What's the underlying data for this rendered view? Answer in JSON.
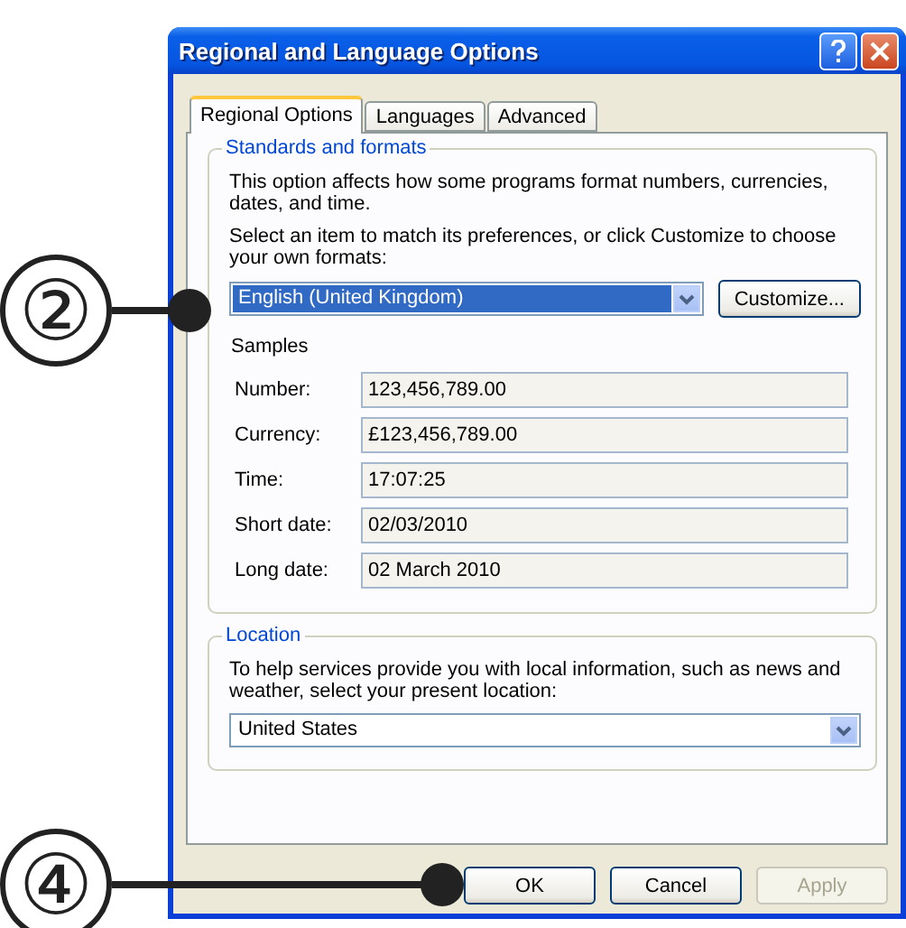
{
  "window": {
    "title": "Regional and Language Options"
  },
  "tabs": [
    {
      "label": "Regional Options",
      "selected": true
    },
    {
      "label": "Languages",
      "selected": false
    },
    {
      "label": "Advanced",
      "selected": false
    }
  ],
  "standards": {
    "legend": "Standards and formats",
    "description": "This option affects how some programs format numbers, currencies, dates, and time.",
    "instruction": "Select an item to match its preferences, or click Customize to choose your own formats:",
    "format": "English (United Kingdom)",
    "customize_button": "Customize...",
    "samples_label": "Samples",
    "samples": [
      {
        "label": "Number:",
        "value": "123,456,789.00"
      },
      {
        "label": "Currency:",
        "value": "£123,456,789.00"
      },
      {
        "label": "Time:",
        "value": "17:07:25"
      },
      {
        "label": "Short date:",
        "value": "02/03/2010"
      },
      {
        "label": "Long date:",
        "value": "02 March 2010"
      }
    ]
  },
  "location": {
    "legend": "Location",
    "description": "To help services provide you with local information, such as news and weather, select your present location:",
    "value": "United States"
  },
  "buttons": [
    {
      "label": "OK",
      "disabled": false
    },
    {
      "label": "Cancel",
      "disabled": false
    },
    {
      "label": "Apply",
      "disabled": true
    }
  ],
  "callouts": [
    {
      "number": "②"
    },
    {
      "number": "④"
    }
  ]
}
